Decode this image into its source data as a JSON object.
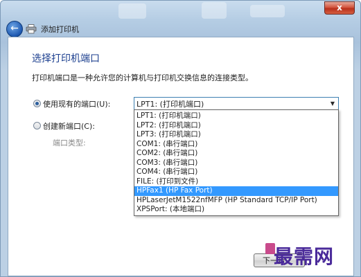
{
  "window": {
    "close_label": "x",
    "title": "添加打印机"
  },
  "page": {
    "heading": "选择打印机端口",
    "description": "打印机端口是一种允许您的计算机与打印机交换信息的连接类型。"
  },
  "options": {
    "use_existing_label": "使用现有的端口(U):",
    "create_new_label": "创建新端口(C):",
    "port_type_label": "端口类型:",
    "selected_option": "use_existing"
  },
  "port_combo": {
    "value": "LPT1: (打印机端口)"
  },
  "port_list": {
    "items": [
      "LPT1: (打印机端口)",
      "LPT2: (打印机端口)",
      "LPT3: (打印机端口)",
      "COM1: (串行端口)",
      "COM2: (串行端口)",
      "COM3: (串行端口)",
      "COM4: (串行端口)",
      "FILE: (打印到文件)",
      "HPFax1 (HP Fax Port)",
      "HPLaserJetM1522nfMFP (HP Standard TCP/IP Port)",
      "XPSPort: (本地端口)"
    ],
    "highlighted_index": 8
  },
  "buttons": {
    "next_label": "下一步"
  },
  "watermark": {
    "text": "最需网"
  },
  "colors": {
    "accent": "#3399ff",
    "heading": "#1c3f8f",
    "close": "#c8432a"
  },
  "icons": {
    "back": "back-arrow-icon",
    "printer": "printer-icon",
    "combo_arrow": "chevron-down-icon"
  }
}
